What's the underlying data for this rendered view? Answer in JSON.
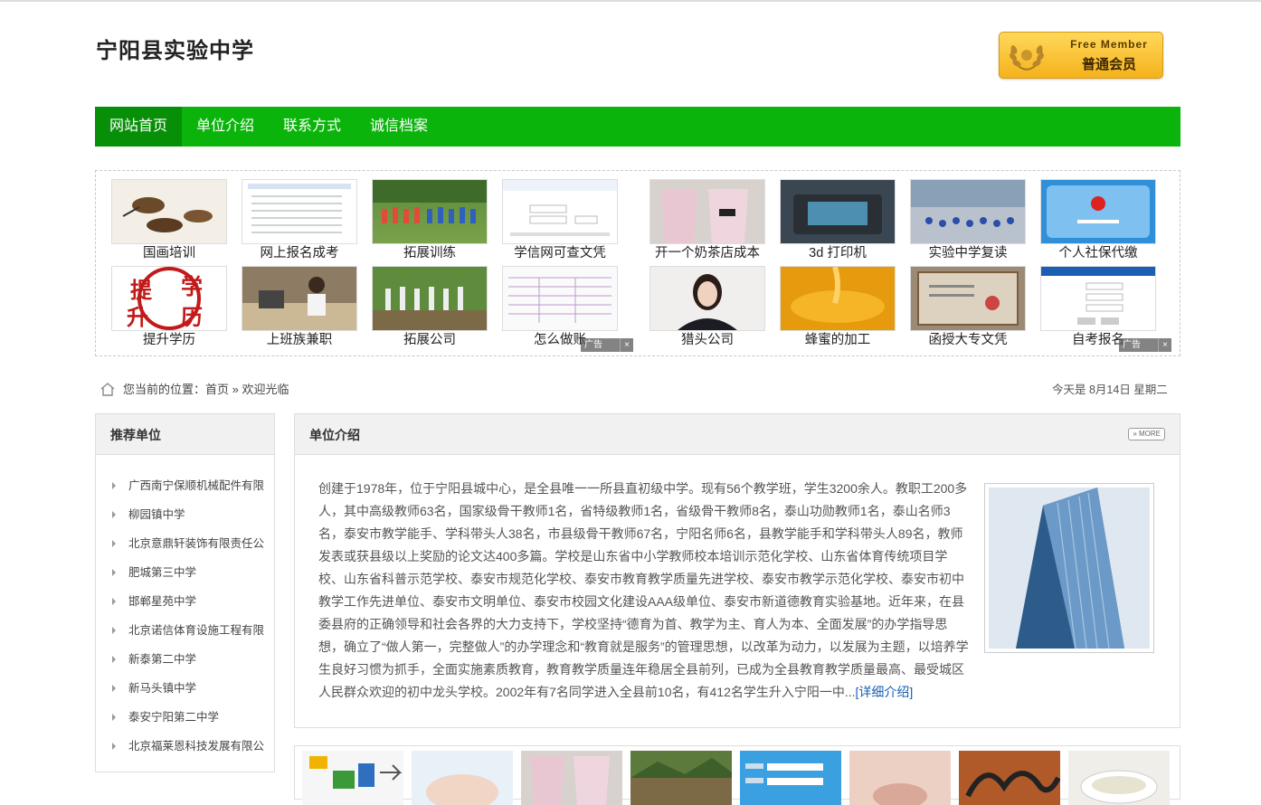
{
  "site": {
    "title": "宁阳县实验中学"
  },
  "member": {
    "en": "Free Member",
    "cn": "普通会员"
  },
  "nav": {
    "items": [
      "网站首页",
      "单位介绍",
      "联系方式",
      "诚信档案"
    ]
  },
  "ads": {
    "row1": [
      "国画培训",
      "网上报名成考",
      "拓展训练",
      "学信网可查文凭",
      "开一个奶茶店成本",
      "3d 打印机",
      "实验中学复读",
      "个人社保代缴"
    ],
    "row2": [
      "提升学历",
      "上班族兼职",
      "拓展公司",
      "怎么做账",
      "猎头公司",
      "蜂蜜的加工",
      "函授大专文凭",
      "自考报名"
    ],
    "badge_label": "广告",
    "badge_close": "×",
    "tile_text": {
      "xueli_a": "提",
      "xueli_b": "学",
      "xueli_c": "升",
      "xueli_d": "历"
    }
  },
  "breadcrumb": {
    "label": "您当前的位置：",
    "home": "首页",
    "sep": " » ",
    "current": "欢迎光临"
  },
  "date": {
    "text": "今天是 8月14日 星期二"
  },
  "sidebar": {
    "title": "推荐单位",
    "items": [
      "广西南宁保顺机械配件有限",
      "柳园镇中学",
      "北京意鼎轩装饰有限责任公",
      "肥城第三中学",
      "邯郸星苑中学",
      "北京诺信体育设施工程有限",
      "新泰第二中学",
      "新马头镇中学",
      "泰安宁阳第二中学",
      "北京福莱恩科技发展有限公"
    ]
  },
  "intro": {
    "title": "单位介绍",
    "more": "MORE",
    "text": "创建于1978年，位于宁阳县城中心，是全县唯一一所县直初级中学。现有56个教学班，学生3200余人。教职工200多人，其中高级教师63名，国家级骨干教师1名，省特级教师1名，省级骨干教师8名，泰山功勋教师1名，泰山名师3名，泰安市教学能手、学科带头人38名，市县级骨干教师67名，宁阳名师6名，县教学能手和学科带头人89名，教师发表或获县级以上奖励的论文达400多篇。学校是山东省中小学教师校本培训示范化学校、山东省体育传统项目学校、山东省科普示范学校、泰安市规范化学校、泰安市教育教学质量先进学校、泰安市教学示范化学校、泰安市初中教学工作先进单位、泰安市文明单位、泰安市校园文化建设AAA级单位、泰安市新道德教育实验基地。近年来，在县委县府的正确领导和社会各界的大力支持下，学校坚持“德育为首、教学为主、育人为本、全面发展”的办学指导思想，确立了“做人第一，完整做人”的办学理念和“教育就是服务”的管理思想，以改革为动力，以发展为主题，以培养学生良好习惯为抓手，全面实施素质教育，教育教学质量连年稳居全县前列，已成为全县教育教学质量最高、最受城区人民群众欢迎的初中龙头学校。2002年有7名同学进入全县前10名，有412名学生升入宁阳一中...",
    "detail_link": "[详细介绍]"
  },
  "colors": {
    "nav_green": "#0ab40a",
    "nav_active": "#078f07",
    "link_blue": "#1a5fb4",
    "badge_gold": "#f5b21c"
  }
}
